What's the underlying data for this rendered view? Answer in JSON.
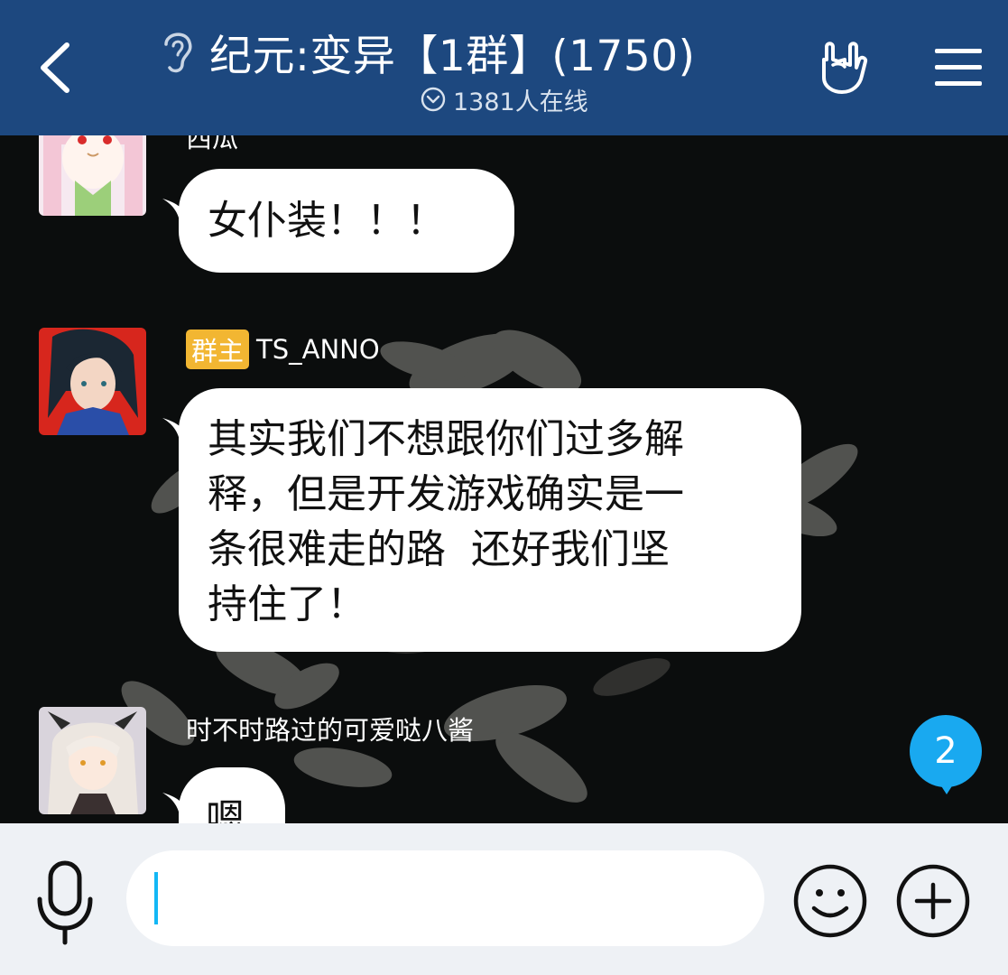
{
  "header": {
    "title": "纪元:变异【1群】(1750)",
    "online_text": "1381人在线"
  },
  "messages": [
    {
      "sender_partial": "西瓜",
      "text": "女仆装！！！"
    },
    {
      "badge": "群主",
      "sender": "TS_ANNO",
      "lines": [
        "其实我们不想跟你们过多解",
        "释，但是开发游戏确实是一",
        "条很难走的路  还好我们坚",
        "持住了！"
      ]
    },
    {
      "sender": "时不时路过的可爱哒八酱",
      "text": "嗯"
    }
  ],
  "unread_count": "2",
  "input": {
    "value": "",
    "placeholder": ""
  },
  "colors": {
    "header_bg": "#1d487f",
    "badge_bg": "#f2b632",
    "unread_bg": "#19a9f0",
    "caret": "#12b7f5",
    "input_bar_bg": "#eef1f5"
  },
  "icons": {
    "back": "chevron-left-icon",
    "ear": "ear-icon",
    "online": "chevron-down-circle-icon",
    "rock": "rock-hand-icon",
    "menu": "hamburger-menu-icon",
    "mic": "microphone-icon",
    "emoji": "smiley-icon",
    "plus": "plus-circle-icon"
  }
}
